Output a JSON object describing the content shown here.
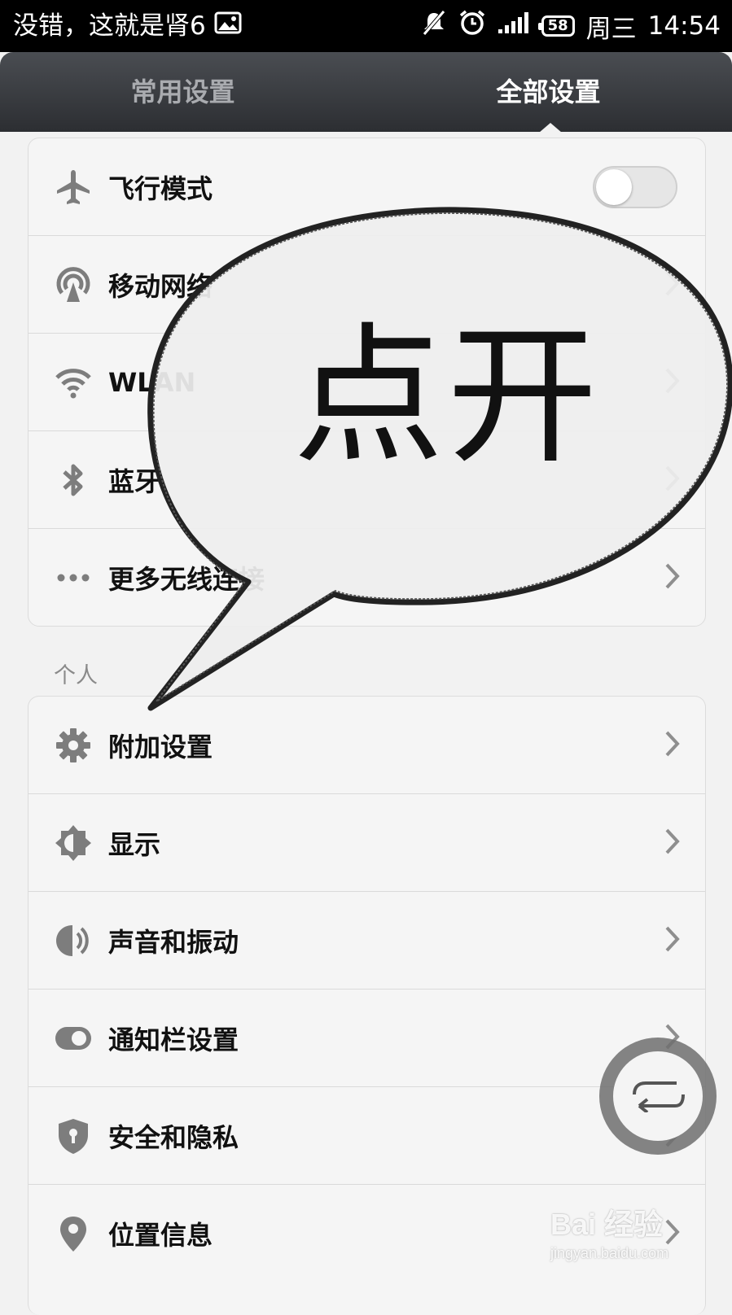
{
  "status_bar": {
    "notification_text": "没错，这就是肾6",
    "battery_level": "58",
    "day": "周三",
    "time": "14:54",
    "icons": [
      "image-icon",
      "mute-icon",
      "alarm-icon",
      "signal-icon",
      "battery-icon"
    ]
  },
  "tabs": [
    {
      "label": "常用设置",
      "active": false
    },
    {
      "label": "全部设置",
      "active": true
    }
  ],
  "wireless_group": {
    "items": [
      {
        "label": "飞行模式",
        "icon": "airplane-icon",
        "control": "toggle",
        "toggle_on": false
      },
      {
        "label": "移动网络",
        "icon": "mobile-network-icon",
        "control": "chevron"
      },
      {
        "label": "WLAN",
        "icon": "wifi-icon",
        "control": "chevron"
      },
      {
        "label": "蓝牙",
        "icon": "bluetooth-icon",
        "control": "chevron"
      },
      {
        "label": "更多无线连接",
        "icon": "more-dots-icon",
        "control": "chevron"
      }
    ]
  },
  "personal_section": {
    "header": "个人",
    "items": [
      {
        "label": "附加设置",
        "icon": "gear-icon",
        "control": "chevron"
      },
      {
        "label": "显示",
        "icon": "brightness-icon",
        "control": "chevron"
      },
      {
        "label": "声音和振动",
        "icon": "speaker-icon",
        "control": "chevron"
      },
      {
        "label": "通知栏设置",
        "icon": "notification-toggle-icon",
        "control": "chevron"
      },
      {
        "label": "安全和隐私",
        "icon": "shield-icon",
        "control": "chevron"
      },
      {
        "label": "位置信息",
        "icon": "location-pin-icon",
        "control": "chevron"
      }
    ]
  },
  "annotation_bubble": {
    "text": "点开"
  },
  "floating_button": {
    "icon": "back-arrow-icon"
  },
  "watermark": {
    "main": "Bai 经验",
    "url": "jingyan.baidu.com"
  },
  "colors": {
    "status_bar_bg": "#000000",
    "tab_bar_bg": "#3a3c40",
    "active_tab_text": "#ffffff",
    "inactive_tab_text": "#a9abaf",
    "icon_gray": "#7d7d7d",
    "page_bg": "#f2f2f2"
  }
}
